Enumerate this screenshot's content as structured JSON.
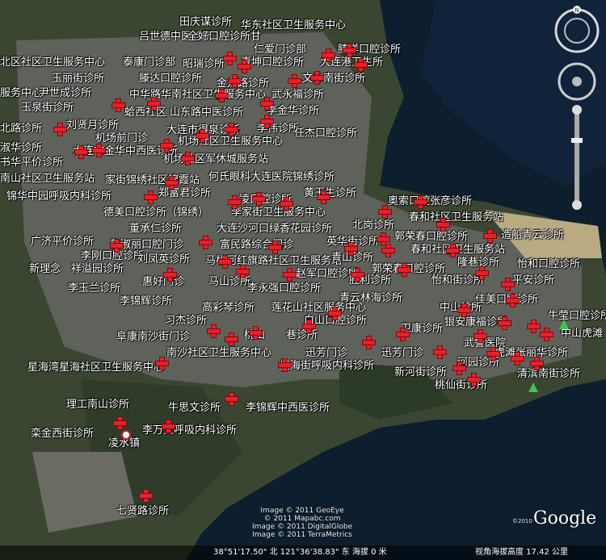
{
  "map": {
    "colors": {
      "sea": "#0d1f2e",
      "land": "#3b4a32",
      "urban": "#6d6f66",
      "pin": "#e8202a"
    },
    "labels": [
      "田庆谋诊所",
      "华东社区卫生服务中心",
      "吕世德中医诊所",
      "全好口腔诊所甘",
      "仁爱门诊部",
      "滕洋口腔诊所",
      "北区社区卫生服务中心",
      "泰康门诊部",
      "昭瑞诊所",
      "青坤口腔诊所",
      "大连港卫生所",
      "玉丽街诊所",
      "滕达口腔诊所",
      "金龙路诊所",
      "文体南街诊所",
      "服务中心",
      "尹世成诊所",
      "中华路华南社区卫生服务中心",
      "武永福诊所",
      "玉泉街诊所",
      "蛤西社区",
      "山东路中医诊所",
      "李金华诊所",
      "北路诊所",
      "刘贤月诊所",
      "大连市得泉诊所",
      "李伟诊所",
      "任杰口腔诊所",
      "机场前门诊",
      "机场社区卫生服务中心",
      "淑华诊所",
      "大连市金华中西医诊所",
      "书华平价诊所",
      "机场社区军休城服务站",
      "南山社区卫生服务站",
      "家街锦绣社区锦霞站",
      "何氏眼科大连医院锦绣诊所",
      "黄玉生诊所",
      "锦华中园呼吸内科诊所",
      "郑富君诊所",
      "凌口腔诊所",
      "奥索口腔张彦诊所",
      "德美口腔诊所（锦绣）",
      "李家街卫生服务中心",
      "春和社区卫生服务站",
      "北岗诊所",
      "董承仁诊所",
      "大连沙河口绿香花园诊所",
      "郭荣春口腔诊所",
      "造船青云诊所",
      "广济平价诊所",
      "范淑丽口腔门诊",
      "富民路综合门诊",
      "英华街诊所",
      "春和社区卫生服务站",
      "新理念",
      "祥溢园诊所",
      "李刚口腔诊所",
      "刘凤英诊所",
      "马栏河红旗路社区卫生服务站",
      "青山诊所",
      "郭荣春口腔诊所",
      "怡和口腔诊所",
      "隆巷诊所",
      "赵军口腔诊所",
      "惠好门诊",
      "马山诊所",
      "胜利诊所",
      "怡和街诊所",
      "平安诊所",
      "李玉兰诊所",
      "李永强口腔诊所",
      "李锦辉诊所",
      "青云林海诊所",
      "佳美口腔诊所",
      "中山诊所",
      "高彩琴诊所",
      "莲花山社区服务中心",
      "牛莹口腔诊所",
      "习杰诊所",
      "白山口腔诊所",
      "银安康福诊所",
      "中山虎滩",
      "桃山",
      "巷诊所",
      "卫康诊所",
      "阜康南沙街门诊",
      "武警医院",
      "南沙社区卫生服务中心",
      "迅芳门诊",
      "迅芳门诊",
      "虎滩张丽华诊所",
      "河园诊所",
      "星海湾星海社区卫生服务中心",
      "星海街呼吸内科诊所",
      "新河街诊所",
      "清滨南街诊所",
      "桃仙街诊所",
      "理工南山诊所",
      "牛思文诊所",
      "李锦辉中西医诊所",
      "栾金西街诊所",
      "李万义呼吸内科诊所",
      "凌水镇",
      "七贤路诊所"
    ]
  },
  "attribution": {
    "lines": [
      "Image © 2011 GeoEye",
      "© 2011 Mapabc.com",
      "Image © 2011 DigitalGlobe",
      "Image © 2011 TerraMetrics"
    ],
    "logo": "Google",
    "logo_year": "©2010"
  },
  "status": {
    "coords": "38°51'17.50\" 北 121°36'38.83\" 东 海拔  0 米",
    "view_altitude": "视角海拔高度  17.42 公里"
  },
  "icons": {
    "pin": "red-cross-pin-icon",
    "compass": "compass-icon",
    "zoom": "zoom-slider-icon",
    "tree": "park-tree-icon"
  }
}
